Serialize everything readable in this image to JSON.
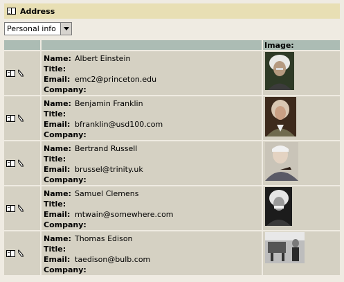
{
  "header": {
    "title": "Address",
    "icon": "address-book-icon"
  },
  "view_select": {
    "value": "Personal info"
  },
  "table": {
    "image_header": "Image:",
    "labels": {
      "name": "Name:",
      "title": "Title:",
      "email": "Email:",
      "company": "Company:"
    },
    "rows": [
      {
        "name": "Albert Einstein",
        "title": "",
        "email": "emc2@princeton.edu",
        "company": ""
      },
      {
        "name": "Benjamin Franklin",
        "title": "",
        "email": "bfranklin@usd100.com",
        "company": ""
      },
      {
        "name": "Bertrand Russell",
        "title": "",
        "email": "brussel@trinity.uk",
        "company": ""
      },
      {
        "name": "Samuel Clemens",
        "title": "",
        "email": "mtwain@somewhere.com",
        "company": ""
      },
      {
        "name": "Thomas Edison",
        "title": "",
        "email": "taedison@bulb.com",
        "company": ""
      }
    ]
  },
  "colors": {
    "title_bar": "#e8dfb4",
    "header_row": "#acbcb4",
    "row_bg": "#d5d1c3",
    "page_bg": "#efebe2"
  }
}
